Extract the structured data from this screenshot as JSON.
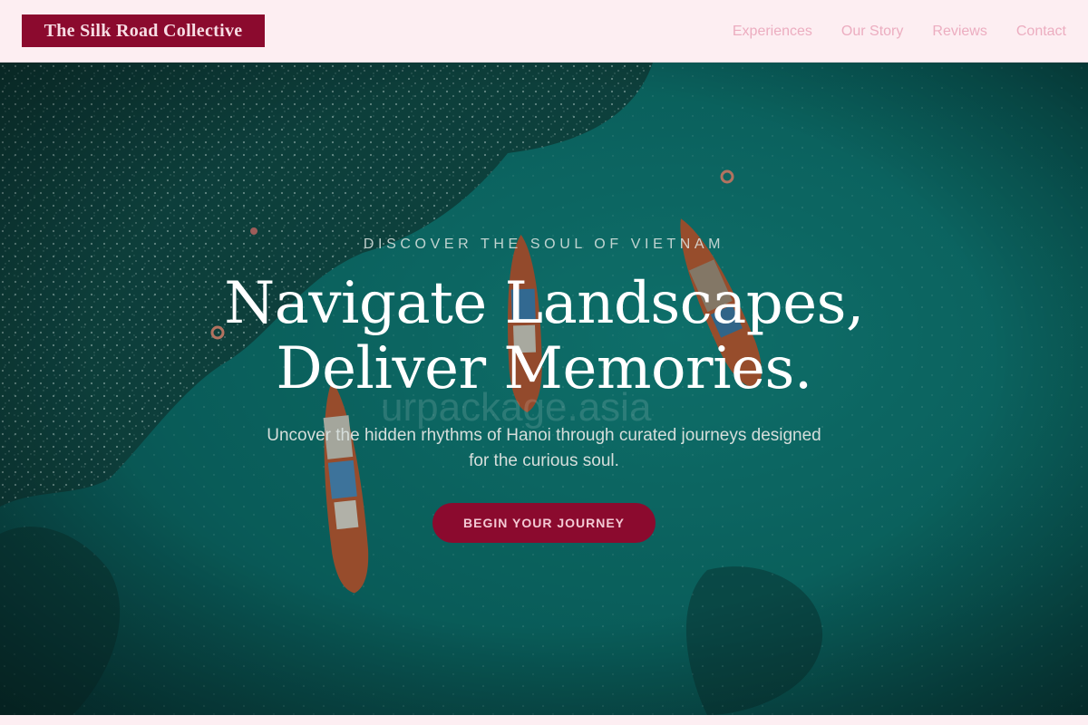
{
  "brand": {
    "name": "The Silk Road Collective",
    "accent_color": "#8b0a2e",
    "header_background": "#fdeef2"
  },
  "nav": {
    "items": [
      {
        "label": "Experiences"
      },
      {
        "label": "Our Story"
      },
      {
        "label": "Reviews"
      },
      {
        "label": "Contact"
      }
    ]
  },
  "hero": {
    "eyebrow": "DISCOVER THE SOUL OF VIETNAM",
    "headline_line1": "Navigate Landscapes,",
    "headline_line2": "Deliver Memories.",
    "subtitle": "Uncover the hidden rhythms of Hanoi through curated journeys designed for the curious soul.",
    "cta_label": "BEGIN YOUR JOURNEY",
    "watermark": "urpackage.asia",
    "background_description": "aerial view of turquoise sea with longtail boats"
  }
}
